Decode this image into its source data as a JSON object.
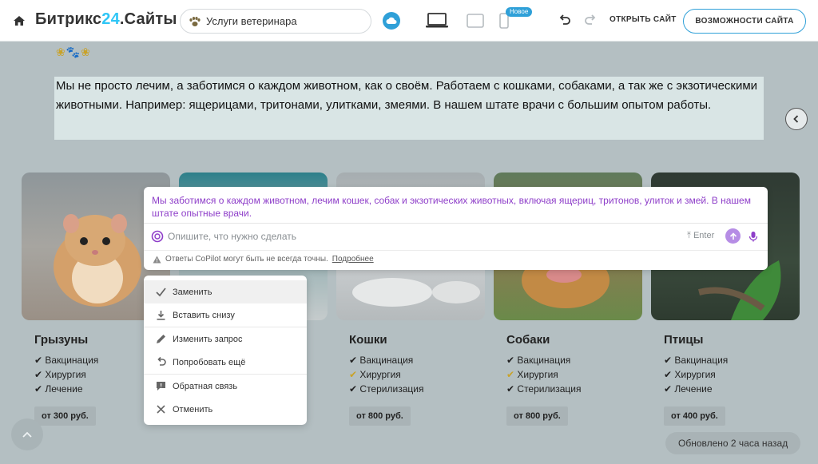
{
  "topbar": {
    "brand_main": "Битрикс",
    "brand_num": "24",
    "brand_suffix": ".Сайты",
    "site_name": "Услуги ветеринара",
    "badge_new": "Новое",
    "open_site": "ОТКРЫТЬ САЙТ",
    "features": "ВОЗМОЖНОСТИ САЙТА"
  },
  "page": {
    "decor": "❀🐾❀",
    "intro_text": "Мы не просто лечим, а заботимся о каждом животном, как о своём. Работаем с кошками, собаками, а так же с экзотическими животными. Например: ящерицами, тритонами, улитками, змеями.  В  нашем штате  врачи с большим опытом работы.",
    "cards": [
      {
        "title": "Грызуны",
        "items": [
          "Вакцинация",
          "Хирургия",
          "Лечение"
        ],
        "price": "от 300 руб."
      },
      {
        "title": "",
        "items": [],
        "price": ""
      },
      {
        "title": "Кошки",
        "items": [
          "Вакцинация",
          "Хирургия",
          "Стерилизация"
        ],
        "price": "от 800 руб."
      },
      {
        "title": "Собаки",
        "items": [
          "Вакцинация",
          "Хирургия",
          "Стерилизация"
        ],
        "price": "от 800 руб."
      },
      {
        "title": "Птицы",
        "items": [
          "Вакцинация",
          "Хирургия",
          "Лечение"
        ],
        "price": "от 400 руб."
      }
    ],
    "updated": "Обновлено 2 часа назад"
  },
  "copilot": {
    "result": "Мы заботимся о каждом животном, лечим кошек, собак и экзотических животных, включая ящериц, тритонов, улиток и змей. В нашем штате опытные врачи.",
    "placeholder": "Опишите, что нужно сделать",
    "enter_hint": "Enter",
    "warning": "Ответы CoPilot могут быть не всегда точны.",
    "more_link": "Подробнее"
  },
  "menu": {
    "items": [
      "Заменить",
      "Вставить снизу",
      "Изменить запрос",
      "Попробовать ещё",
      "Обратная связь",
      "Отменить"
    ]
  },
  "colors": {
    "accent": "#2fa0d8",
    "copilot_purple": "#8e3ec9",
    "check_orange": "#c9a227"
  }
}
